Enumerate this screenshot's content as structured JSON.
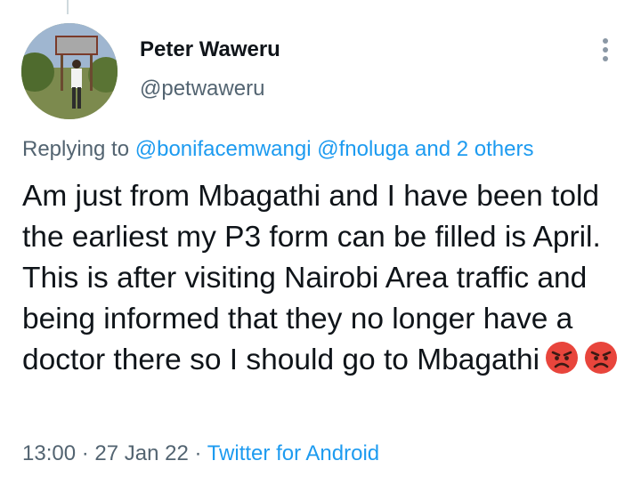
{
  "tweet": {
    "author_name": "Peter Waweru",
    "author_handle": "@petwaweru",
    "replying_prefix": "Replying to ",
    "reply_mention_1": "@bonifacemwangi",
    "reply_mention_2": "@fnoluga",
    "reply_and": " and ",
    "reply_others": "2 others",
    "text": "Am just from Mbagathi and I have been told the earliest my P3 form can be filled is April. This is after visiting Nairobi Area traffic and being informed that they no longer have a doctor there so I should go to Mbagathi",
    "emojis": [
      "angry-face-icon",
      "angry-face-icon"
    ],
    "time": "13:00",
    "date": "27 Jan 22",
    "separator": " · ",
    "source": "Twitter for Android"
  },
  "colors": {
    "text": "#0f1419",
    "secondary": "#536471",
    "link": "#1d9bf0"
  }
}
